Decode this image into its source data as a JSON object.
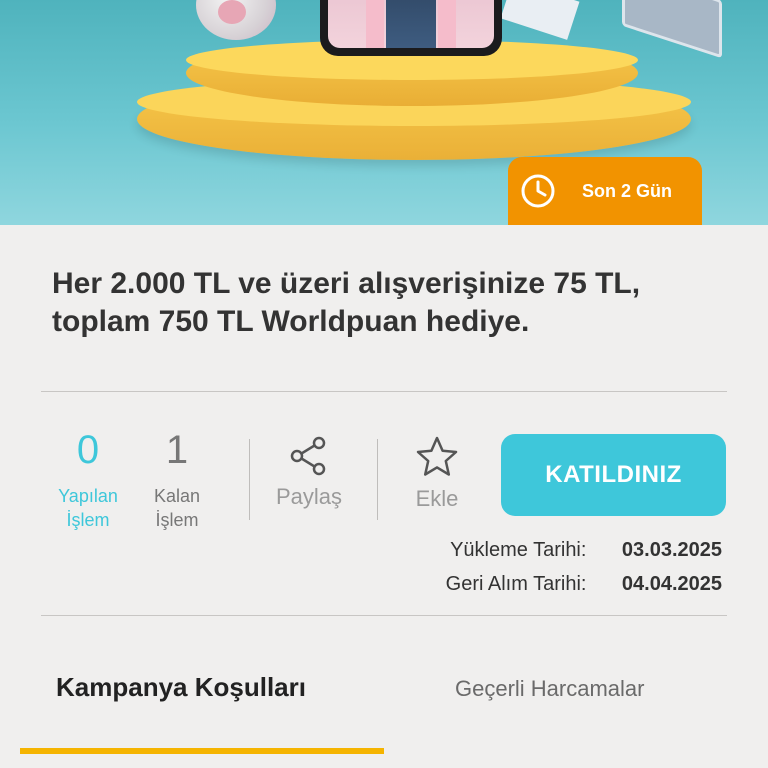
{
  "banner": {
    "badge_label": "Son 2 Gün",
    "badge_color": "#f29300"
  },
  "campaign": {
    "title": "Her 2.000 TL ve üzeri alışverişinize 75 TL, toplam 750 TL Worldpuan hediye."
  },
  "stats": {
    "done_count": "0",
    "done_label": "Yapılan İşlem",
    "remaining_count": "1",
    "remaining_label": "Kalan İşlem"
  },
  "actions": {
    "share_label": "Paylaş",
    "add_label": "Ekle",
    "join_label": "KATILDINIZ"
  },
  "dates": {
    "upload_label": "Yükleme Tarihi:",
    "upload_value": "03.03.2025",
    "redeem_label": "Geri Alım Tarihi:",
    "redeem_value": "04.04.2025"
  },
  "tabs": {
    "conditions": "Kampanya Koşulları",
    "valid_spending": "Geçerli Harcamalar"
  },
  "colors": {
    "accent_teal": "#3ec7da",
    "accent_orange": "#f29300",
    "tab_indicator": "#f5b400"
  }
}
